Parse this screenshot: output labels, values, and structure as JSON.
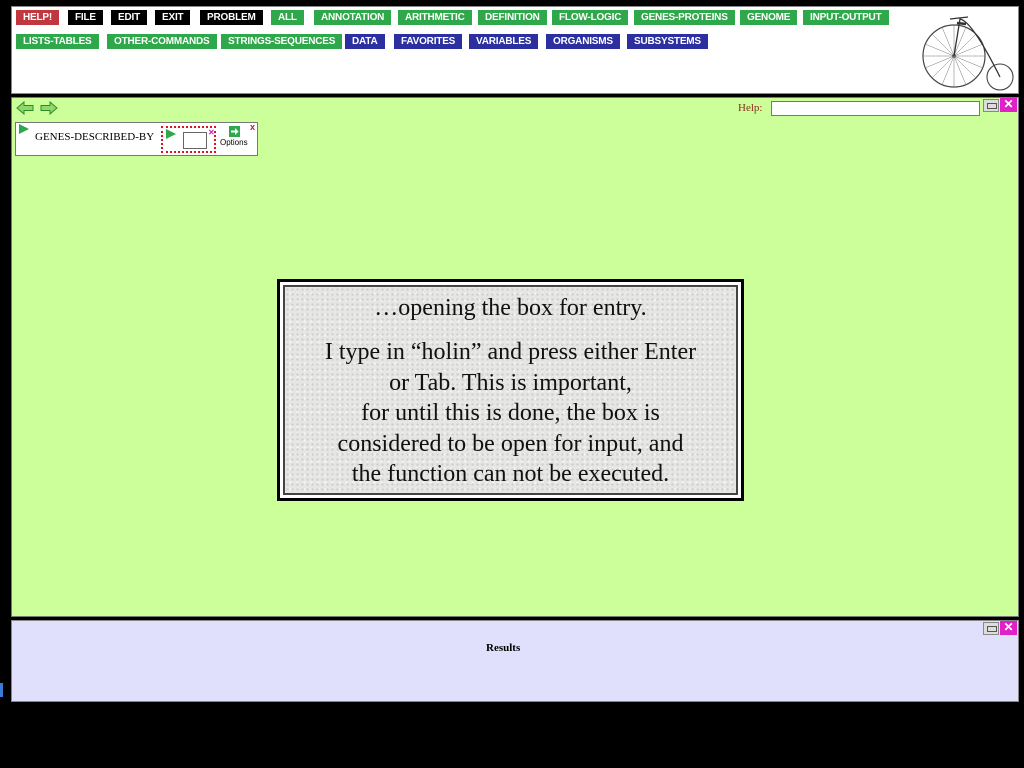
{
  "menu": {
    "row1": [
      {
        "label": "HELP!",
        "color": "#c0373f"
      },
      {
        "label": "FILE",
        "color": "#000000"
      },
      {
        "label": "EDIT",
        "color": "#000000"
      },
      {
        "label": "EXIT",
        "color": "#000000"
      },
      {
        "label": "PROBLEM",
        "color": "#000000"
      },
      {
        "label": "ALL",
        "color": "#2ea84a"
      },
      {
        "label": "ANNOTATION",
        "color": "#2ea84a"
      },
      {
        "label": "ARITHMETIC",
        "color": "#2ea84a"
      },
      {
        "label": "DEFINITION",
        "color": "#2ea84a"
      },
      {
        "label": "FLOW-LOGIC",
        "color": "#2ea84a"
      },
      {
        "label": "GENES-PROTEINS",
        "color": "#2ea84a"
      },
      {
        "label": "GENOME",
        "color": "#2ea84a"
      },
      {
        "label": "INPUT-OUTPUT",
        "color": "#2ea84a"
      }
    ],
    "row2": [
      {
        "label": "LISTS-TABLES",
        "color": "#2ea84a"
      },
      {
        "label": "OTHER-COMMANDS",
        "color": "#2ea84a"
      },
      {
        "label": "STRINGS-SEQUENCES",
        "color": "#2ea84a"
      },
      {
        "label": "DATA",
        "color": "#2b2fa0"
      },
      {
        "label": "FAVORITES",
        "color": "#2b2fa0"
      },
      {
        "label": "VARIABLES",
        "color": "#2b2fa0"
      },
      {
        "label": "ORGANISMS",
        "color": "#2b2fa0"
      },
      {
        "label": "SUBSYSTEMS",
        "color": "#2b2fa0"
      }
    ],
    "logo_icon": "penny-farthing-bicycle-icon"
  },
  "workspace": {
    "background": "#ccff99",
    "help_label": "Help:",
    "help_value": "",
    "function_box": {
      "name": "GENES-DESCRIBED-BY",
      "argument_value": "",
      "options_label": "Options",
      "close_glyph": "x"
    }
  },
  "caption": {
    "line1": "…opening the box for entry.",
    "body_lines": [
      "I type in “holin” and press either Enter",
      "or Tab. This is important,",
      "for until this is done, the box is",
      "considered to be open for input, and",
      "the function can not be executed."
    ]
  },
  "results": {
    "label": "Results",
    "background": "#e0e0fc"
  },
  "window_controls": {
    "close_glyph": "✕"
  }
}
